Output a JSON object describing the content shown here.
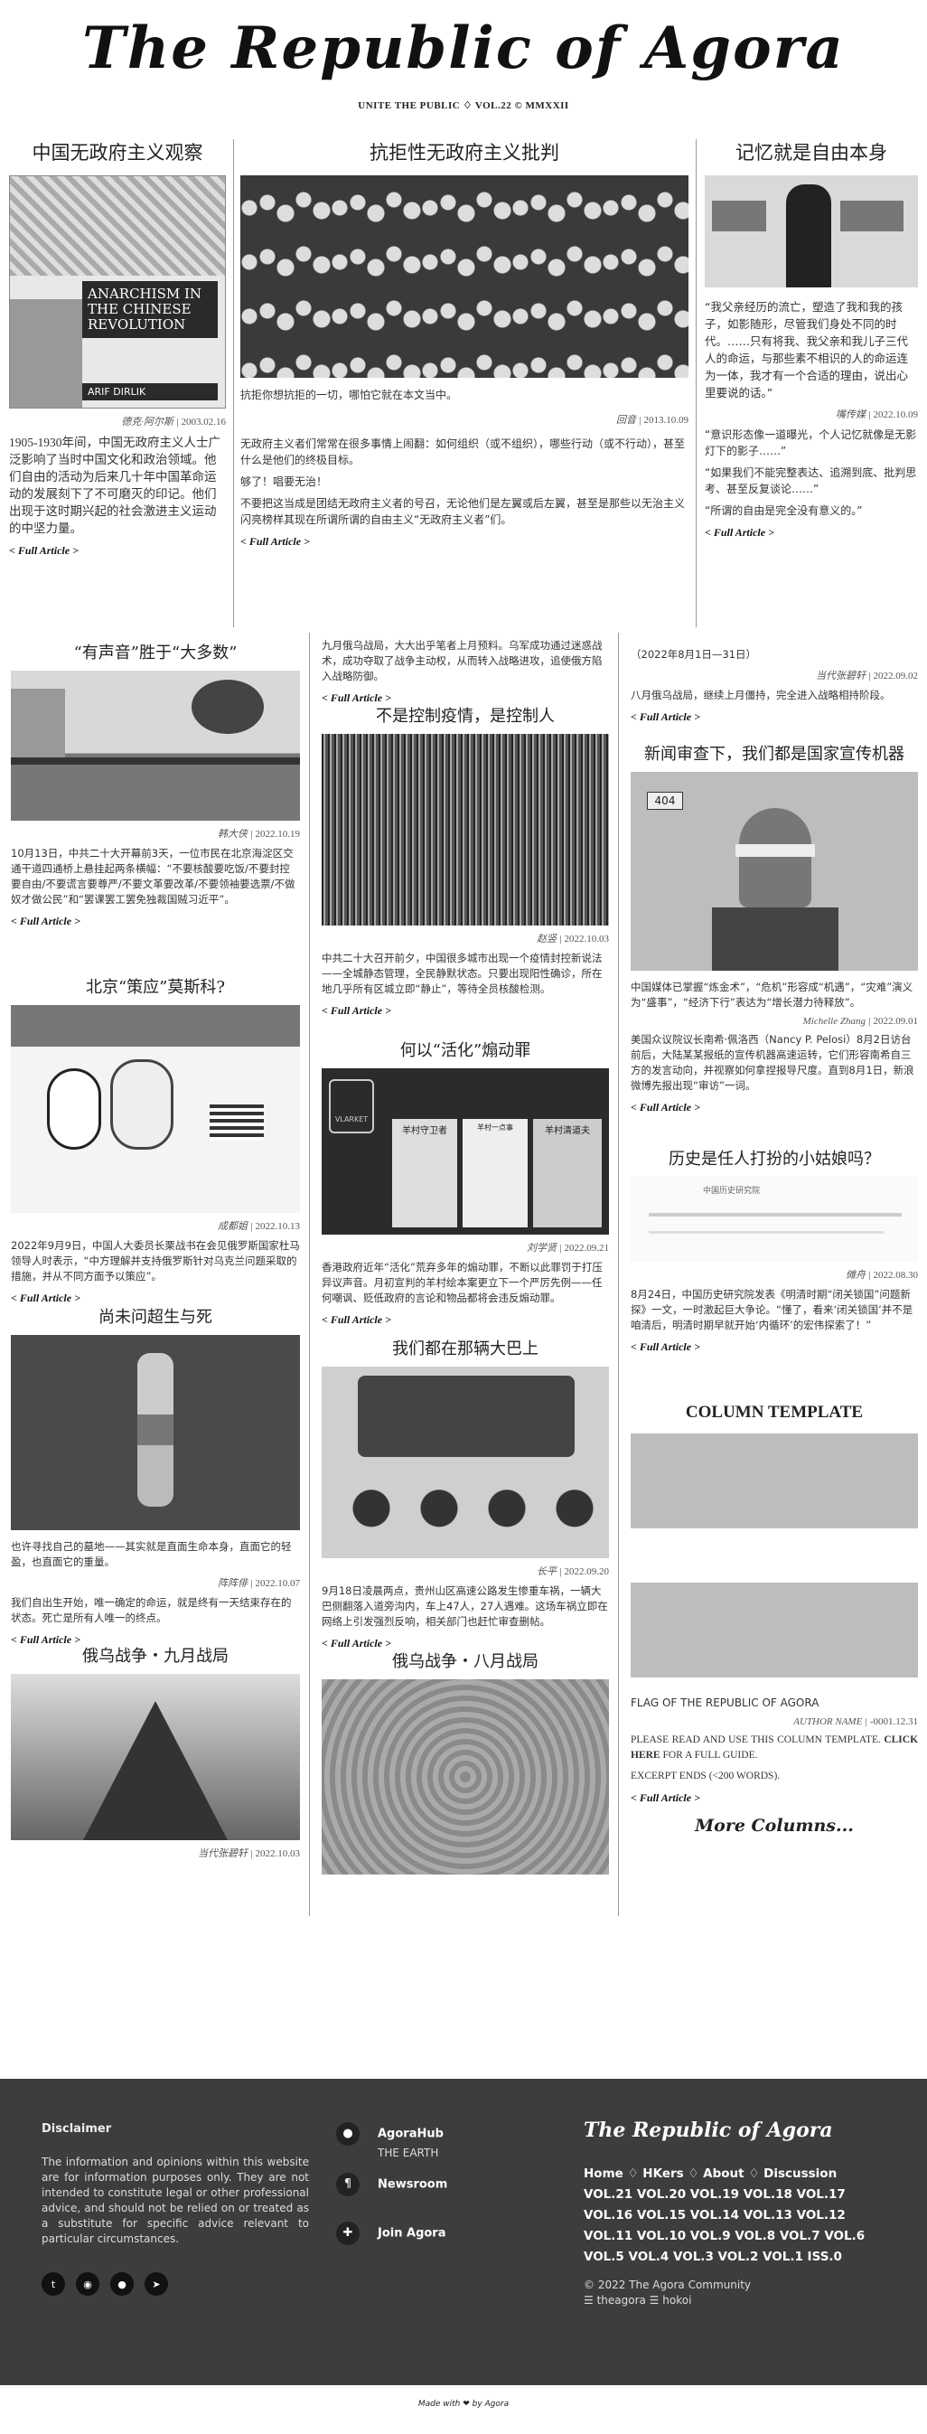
{
  "masthead": {
    "title": "The Republic of Agora",
    "tagline": "UNITE THE PUBLIC ♢ VOL.22 © MMXXII"
  },
  "top": [
    {
      "title": "中国无政府主义观察",
      "image_label": "ANARCHISM IN THE CHINESE REVOLUTION",
      "image_author": "ARIF DIRLIK",
      "author": "德克·阿尔斯",
      "date": "2003.02.16",
      "text": "1905-1930年间，中国无政府主义人士广泛影响了当时中国文化和政治领域。他们自由的活动为后来几十年中国革命运动的发展刻下了不可磨灭的印记。他们出现于这时期兴起的社会激进主义运动的中坚力量。",
      "more": "< Full Article >"
    },
    {
      "title": "抗拒性无政府主义批判",
      "caption": "抗拒你想抗拒的一切，哪怕它就在本文当中。",
      "author": "回音",
      "date": "2013.10.09",
      "text1": "无政府主义者们常常在很多事情上闹翻：如何组织（或不组织），哪些行动（或不行动），甚至什么是他们的终极目标。",
      "text2": "够了！唱要无治！",
      "text3": "不要把这当成是团结无政府主义者的号召，无论他们是左翼或后左翼，甚至是那些以无治主义闪亮榜样其现在所谓所谓的自由主义“无政府主义者”们。",
      "more": "< Full Article >"
    },
    {
      "title": "记忆就是自由本身",
      "quote": "“我父亲经历的流亡，塑造了我和我的孩子，如影随形，尽管我们身处不同的时代。……只有将我、我父亲和我儿子三代人的命运，与那些素不相识的人的命运连为一体，我才有一个合适的理由，说出心里要说的话。”",
      "author": "嘴传媒",
      "date": "2022.10.09",
      "text1": "“意识形态像一道曝光，个人记忆就像是无影灯下的影子……”",
      "text2": "“如果我们不能完整表达、追溯到底、批判思考、甚至反复谈论……”",
      "text3": "“所谓的自由是完全没有意义的。”",
      "more": "< Full Article >"
    }
  ],
  "left": [
    {
      "title": "“有声音”胜于“大多数”",
      "author": "韩大侠",
      "date": "2022.10.19",
      "text": "10月13日，中共二十大开幕前3天，一位市民在北京海淀区交通干道四通桥上悬挂起两条横幅：“不要核酸要吃饭/不要封控要自由/不要谎言要尊严/不要文革要改革/不要领袖要选票/不做奴才做公民”和“罢课罢工罢免独裁国贼习近平”。",
      "more": "< Full Article >"
    },
    {
      "title": "北京“策应”莫斯科?",
      "author": "成都姐",
      "date": "2022.10.13",
      "text": "2022年9月9日，中国人大委员长栗战书在会见俄罗斯国家杜马领导人时表示，“中方理解并支持俄罗斯针对乌克兰问题采取的措施，并从不同方面予以策应”。",
      "more": "< Full Article >"
    },
    {
      "title": "尚未问超生与死",
      "author": "阵阵俳",
      "date": "2022.10.07",
      "text1": "也许寻找自己的墓地——其实就是直面生命本身，直面它的轻盈，也直面它的重量。",
      "text2": "我们自出生开始，唯一确定的命运，就是终有一天结束存在的状态。死亡是所有人唯一的终点。",
      "more": "< Full Article >"
    },
    {
      "title": "俄乌战争・九月战局",
      "author": "当代张碧轩",
      "date": "2022.10.03"
    }
  ],
  "mid": [
    {
      "text": "九月俄乌战局，大大出乎笔者上月预料。乌军成功通过迷惑战术，成功夺取了战争主动权，从而转入战略进攻，追使俄方陷入战略防御。",
      "more": "< Full Article >"
    },
    {
      "title": "不是控制疫情，是控制人",
      "author": "赵竖",
      "date": "2022.10.03",
      "text": "中共二十大召开前夕，中国很多城市出现一个疫情封控新说法——全城静态管理，全民静默状态。只要出现阳性确诊，所在地几乎所有区城立即“静止”，等待全员核酸检测。",
      "more": "< Full Article >"
    },
    {
      "title": "何以“活化”煽动罪",
      "poster_brand": "VLARKET",
      "panel1": "羊村守卫者",
      "panel2": "羊村一点事",
      "panel3": "羊村清道夫",
      "author": "刘学贤",
      "date": "2022.09.21",
      "text": "香港政府近年“活化”荒弃多年的煽动罪，不断以此罪罚于打压异议声音。月初宣判的羊村绘本案更立下一个严厉先例——任何嘲讽、贬低政府的言论和物品都将会违反煽动罪。",
      "more": "< Full Article >"
    },
    {
      "title": "我们都在那辆大巴上",
      "author": "长平",
      "date": "2022.09.20",
      "text": "9月18日凌晨两点，贵州山区高速公路发生惨重车祸，一辆大巴侧翻落入道旁沟内，车上47人，27人遇难。这场车祸立即在网络上引发强烈反响，相关部门也赶忙审查删帖。",
      "more": "< Full Article >"
    },
    {
      "title": "俄乌战争・八月战局"
    }
  ],
  "right": [
    {
      "text0": "（2022年8月1日—31日）",
      "author": "当代张碧轩",
      "date": "2022.09.02",
      "text": "八月俄乌战局，继续上月僵持，完全进入战略相持阶段。",
      "more": "< Full Article >"
    },
    {
      "title": "新闻审查下，我们都是国家宣传机器",
      "door_number": "404",
      "author": "Michelle Zhang",
      "date": "2022.09.01",
      "text1": "中国媒体已掌握“炼金术”，“危机”形容成“机遇”，“灾难”演义为“盛事”，“经济下行”表达为“增长潜力待释放”。",
      "text2": "美国众议院议长南希·佩洛西（Nancy P. Pelosi）8月2日访台前后，大陆某某报纸的宣传机器高速运转，它们形容南希自三方的发言动向，并视察如何拿捏报导尺度。直到8月1日，新浪微博先报出现“审访”一词。",
      "more": "< Full Article >"
    },
    {
      "title": "历史是任人打扮的小姑娘吗？",
      "doc_heading": "中国历史研究院",
      "author": "傩舟",
      "date": "2022.08.30",
      "text": "8月24日，中国历史研究院发表《明清时期“闭关锁国”问题新探》一文，一时激起巨大争论。“懂了，看来‘闭关锁国’并不是咱清后，明清时期早就开始‘内循环’的宏伟探索了！”",
      "more": "< Full Article >"
    },
    {
      "title": "COLUMN TEMPLATE",
      "flag": "FLAG OF THE REPUBLIC OF AGORA",
      "author": "AUTHOR NAME",
      "date": "-0001.12.31",
      "text_a": "PLEASE READ AND USE THIS COLUMN TEMPLATE.",
      "text_b": "CLICK HERE",
      "text_c": "FOR A FULL GUIDE.",
      "text_d": "EXCERPT ENDS (<200 WORDS).",
      "more": "< Full Article >",
      "more_columns": "More Columns..."
    }
  ],
  "footer": {
    "disclaimer_title": "Disclaimer",
    "disclaimer": "The information and opinions within this website are for information purposes only. They are not intended to constitute legal or other professional advice, and should not be relied on or treated as a substitute for specific advice relevant to particular circumstances.",
    "social": [
      "twitter-icon",
      "github-icon",
      "reddit-icon",
      "telegram-icon"
    ],
    "links": [
      {
        "label": "AgoraHub",
        "sub": "THE EARTH",
        "icon": "●"
      },
      {
        "label": "Newsroom",
        "sub": "",
        "icon": "¶"
      },
      {
        "label": "Join Agora",
        "sub": "",
        "icon": "✚"
      }
    ],
    "site_title": "The Republic of Agora",
    "menu": "Home ♢ HKers ♢ About ♢ Discussion",
    "vols1": "VOL.21 VOL.20 VOL.19 VOL.18 VOL.17",
    "vols2": "VOL.16 VOL.15 VOL.14 VOL.13 VOL.12",
    "vols3": "VOL.11 VOL.10 VOL.9 VOL.8 VOL.7 VOL.6",
    "vols4": "VOL.5 VOL.4 VOL.3 VOL.2 VOL.1 ISS.0",
    "copyright": "© 2022 The Agora Community",
    "handles": "☰ theagora ☰ hokoi"
  },
  "made_with": "Made with ❤ by Agora"
}
